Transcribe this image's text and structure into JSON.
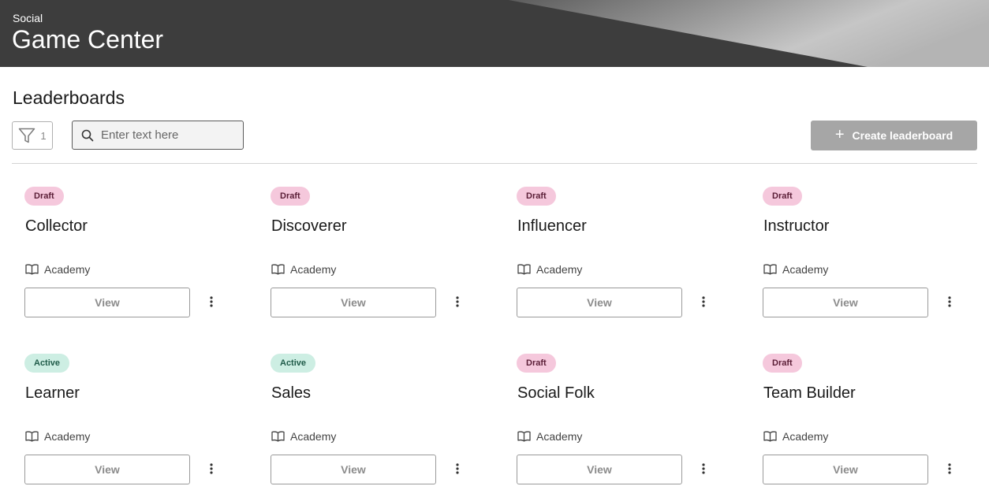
{
  "header": {
    "subtitle": "Social",
    "title": "Game Center"
  },
  "section": {
    "title": "Leaderboards"
  },
  "toolbar": {
    "filter_count": "1",
    "search_placeholder": "Enter text here",
    "search_value": "",
    "create_label": "Create leaderboard"
  },
  "card_common": {
    "view_label": "View"
  },
  "cards": [
    {
      "status": "Draft",
      "name": "Collector",
      "category": "Academy"
    },
    {
      "status": "Draft",
      "name": "Discoverer",
      "category": "Academy"
    },
    {
      "status": "Draft",
      "name": "Influencer",
      "category": "Academy"
    },
    {
      "status": "Draft",
      "name": "Instructor",
      "category": "Academy"
    },
    {
      "status": "Active",
      "name": "Learner",
      "category": "Academy"
    },
    {
      "status": "Active",
      "name": "Sales",
      "category": "Academy"
    },
    {
      "status": "Draft",
      "name": "Social Folk",
      "category": "Academy"
    },
    {
      "status": "Draft",
      "name": "Team Builder",
      "category": "Academy"
    }
  ],
  "colors": {
    "header_bg": "#3d3d3d",
    "draft_badge": "#f5c8dc",
    "active_badge": "#cdeee3",
    "create_button": "#a6a6a6"
  }
}
